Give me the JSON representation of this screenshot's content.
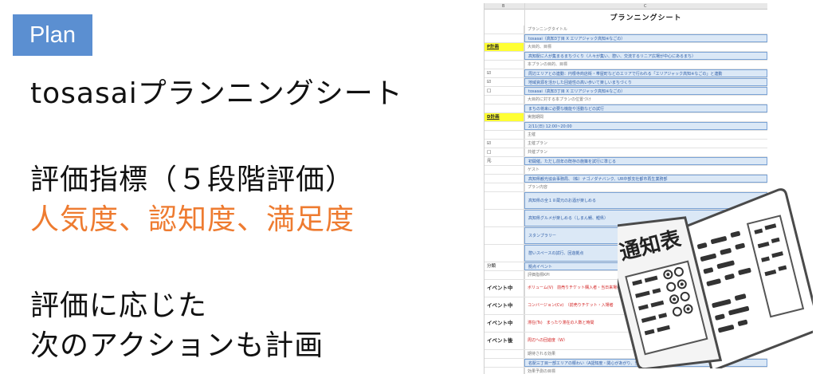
{
  "badge": "Plan",
  "left_lines": {
    "l1": "tosasaiプランニングシート",
    "l2": "評価指標（５段階評価）",
    "l3": "人気度、認知度、満足度",
    "l4": "評価に応じた",
    "l5": "次のアクションも計画"
  },
  "sheet": {
    "col_b": "B",
    "col_c": "C",
    "title": "プランニングシート",
    "rows": [
      {
        "a": "",
        "c": "プランニングタイトル",
        "style": "gray"
      },
      {
        "a": "",
        "c": "tosasai（高知3丁目 X エリアジャック高知※なごの）",
        "style": "blue"
      },
      {
        "a": "P計画",
        "c": "大目的、目標",
        "style": "gray",
        "ahl": true
      },
      {
        "a": "",
        "c": "高知駅に人が集まるまちづくり（人々が集い、憩い、交流するリニア広場が中心にあるまち）",
        "style": "blue"
      },
      {
        "a": "",
        "c": "本プランの目的、目標",
        "style": "gray"
      },
      {
        "a": "☑",
        "c": "周辺エリアとの連動：円根寺商店街・帯屋町などのエリアで行われる「エリアジャック高知※なごの」と連動",
        "style": "blue"
      },
      {
        "a": "☑",
        "c": "地域資源を活かした回遊性の高い歩いて楽しいまちづくり",
        "style": "blue"
      },
      {
        "a": "□",
        "c": "tosasai（高知3丁目 X エリアジャック高知※なごの）",
        "style": "blue"
      },
      {
        "a": "",
        "c": "大目的に対する本プランの位置づけ",
        "style": "gray"
      },
      {
        "a": "",
        "c": "まちの将来に必要な機能や活動などの試行",
        "style": "blue"
      },
      {
        "a": "D計画",
        "c": "実施期間",
        "style": "gray",
        "ahl": true
      },
      {
        "a": "",
        "c": "2/11(日) 12:00~20:00",
        "style": "blue"
      },
      {
        "a": "",
        "c": "主催",
        "style": "gray"
      },
      {
        "a": "☑",
        "c": "主催プラン",
        "style": "gray"
      },
      {
        "a": "□",
        "c": "共催プラン",
        "style": "gray"
      },
      {
        "a": "元",
        "c": "初開催。ただし前年の既存の施策を試行に準じる",
        "style": "blue"
      },
      {
        "a": "",
        "c": "ゲスト",
        "style": "gray"
      },
      {
        "a": "",
        "c": "高知県観光協会事務局、（株）ナゴノダナバンク、UR中部支社都市再生業務部",
        "style": "blue"
      },
      {
        "a": "",
        "c": "プラン内容",
        "style": "gray"
      },
      {
        "a": "",
        "c": "高知県の全１８蔵元のお酒が楽しめる",
        "style": "blue",
        "tall": true
      },
      {
        "a": "",
        "c": "高知県グルメが楽しめる（しまん鯖、鰹県）",
        "style": "blue",
        "tall": true
      },
      {
        "a": "",
        "c": "スタンプラリー",
        "style": "blue",
        "tall": true
      },
      {
        "a": "",
        "c": "憩いスペースの試行、回遊拠点",
        "style": "blue",
        "tall": true
      },
      {
        "a": "分類",
        "c": "拠点イベント",
        "style": "blue"
      },
      {
        "a": "",
        "c": "評価指標KPI",
        "style": "gray"
      },
      {
        "a": "イベント中",
        "c": "ボリューム(V)　前売りチケット購入者・当日来場者",
        "style": "red",
        "tall": true,
        "big": true
      },
      {
        "a": "イベント中",
        "c": "コンバージョン(Cv)　（前売りチケット・入場者",
        "style": "red",
        "tall": true,
        "big": true
      },
      {
        "a": "イベント中",
        "c": "滞在(Ts)　まったり滞在の人数と時間",
        "style": "red",
        "tall": true,
        "big": true
      },
      {
        "a": "イベント後",
        "c": "周辺への回遊度（W）",
        "style": "red",
        "tall": true,
        "big": true
      },
      {
        "a": "",
        "c": "期待される効果",
        "style": "gray"
      },
      {
        "a": "",
        "c": "名駅三丁目一部エリアの賑わい（A認知度・関心があがり、当日は賑わう）",
        "style": "blue"
      },
      {
        "a": "",
        "c": "効果予測の目標",
        "style": "gray"
      },
      {
        "a": "",
        "c": "「エリアジャック高知なごの」スタンプラリーのスタンプ対象",
        "style": "blue"
      }
    ]
  },
  "illustration": {
    "icon": "report-card-icon",
    "cover_text": "通知表"
  },
  "colors": {
    "badge": "#5b8fd1",
    "orange": "#ee7b30",
    "cell_blue": "#dbe8f6",
    "highlight": "#ffff33"
  }
}
